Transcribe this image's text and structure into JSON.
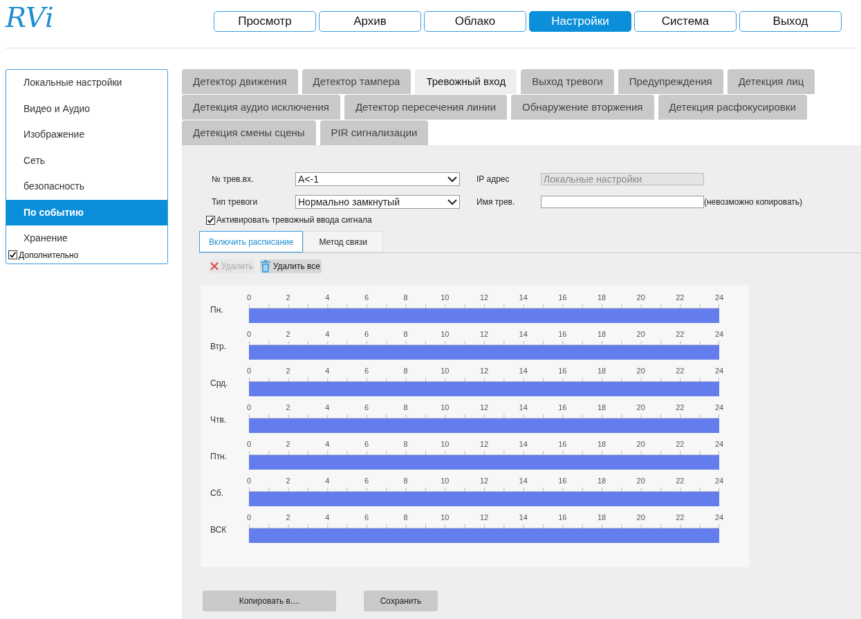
{
  "logo": "RVi",
  "nav": [
    {
      "label": "Просмотр",
      "selected": false
    },
    {
      "label": "Архив",
      "selected": false
    },
    {
      "label": "Облако",
      "selected": false
    },
    {
      "label": "Настройки",
      "selected": true
    },
    {
      "label": "Система",
      "selected": false
    },
    {
      "label": "Выход",
      "selected": false
    }
  ],
  "sidebar": {
    "items": [
      {
        "label": "Локальные настройки",
        "selected": false
      },
      {
        "label": "Видео и Аудио",
        "selected": false
      },
      {
        "label": "Изображение",
        "selected": false
      },
      {
        "label": "Сеть",
        "selected": false
      },
      {
        "label": "безопасность",
        "selected": false
      },
      {
        "label": "По событию",
        "selected": true
      },
      {
        "label": "Хранение",
        "selected": false
      }
    ],
    "advanced": {
      "label": "Дополнительно",
      "checked": true
    }
  },
  "tab_rows": [
    [
      {
        "label": "Детектор движения",
        "selected": false
      },
      {
        "label": "Детектор тампера",
        "selected": false
      },
      {
        "label": "Тревожный вход",
        "selected": true
      },
      {
        "label": "Выход тревоги",
        "selected": false
      },
      {
        "label": "Предупреждения",
        "selected": false
      },
      {
        "label": "Детекция лиц",
        "selected": false
      }
    ],
    [
      {
        "label": "Детекция аудио исключения",
        "selected": false
      },
      {
        "label": "Детектор пересечения линии",
        "selected": false
      },
      {
        "label": "Обнаружение вторжения",
        "selected": false
      },
      {
        "label": "Детекция расфокусировки",
        "selected": false
      }
    ],
    [
      {
        "label": "Детекция смены сцены",
        "selected": false
      },
      {
        "label": "PIR сигнализации",
        "selected": false
      }
    ]
  ],
  "form": {
    "alarm_input": {
      "label": "№ трев.вх.",
      "value": "A<-1"
    },
    "ip_address": {
      "label": "IP адрес",
      "value": "Локальные настройки",
      "disabled": true
    },
    "alarm_type": {
      "label": "Тип тревоги",
      "value": "Нормально замкнутый"
    },
    "alarm_name": {
      "label": "Имя трев.",
      "note": "(невозможно копировать)"
    },
    "activate": {
      "label": "Активировать тревожный ввода сигнала",
      "checked": true
    }
  },
  "subtabs": [
    {
      "label": "Включить расписание",
      "selected": true
    },
    {
      "label": "Метод связи",
      "selected": false
    }
  ],
  "toolbar": [
    {
      "kind": "delete",
      "label": "Удалить",
      "disabled": true
    },
    {
      "kind": "delete_all",
      "label": "Удалить все",
      "disabled": false
    }
  ],
  "schedule": [
    {
      "day": "Пн.",
      "level": 1,
      "ticks": [
        "0",
        "2",
        "4",
        "6",
        "8",
        "10",
        "12",
        "14",
        "16",
        "18",
        "20",
        "22",
        "24"
      ]
    },
    {
      "day": "Втр.",
      "level": 1,
      "ticks": [
        "0",
        "2",
        "4",
        "6",
        "8",
        "10",
        "12",
        "14",
        "16",
        "18",
        "20",
        "22",
        "24"
      ]
    },
    {
      "day": "Срд.",
      "level": 1,
      "ticks": [
        "0",
        "2",
        "4",
        "6",
        "8",
        "10",
        "12",
        "14",
        "16",
        "18",
        "20",
        "22",
        "24"
      ]
    },
    {
      "day": "Чтв.",
      "level": 1,
      "ticks": [
        "0",
        "2",
        "4",
        "6",
        "8",
        "10",
        "12",
        "14",
        "16",
        "18",
        "20",
        "22",
        "24"
      ]
    },
    {
      "day": "Птн.",
      "level": 1,
      "ticks": [
        "0",
        "2",
        "4",
        "6",
        "8",
        "10",
        "12",
        "14",
        "16",
        "18",
        "20",
        "22",
        "24"
      ]
    },
    {
      "day": "Сб.",
      "level": 1,
      "ticks": [
        "0",
        "2",
        "4",
        "6",
        "8",
        "10",
        "12",
        "14",
        "16",
        "18",
        "20",
        "22",
        "24"
      ]
    },
    {
      "day": "ВСК",
      "level": 1,
      "ticks": [
        "0",
        "2",
        "4",
        "6",
        "8",
        "10",
        "12",
        "14",
        "16",
        "18",
        "20",
        "22",
        "24"
      ]
    }
  ],
  "buttons": [
    "Копировать в....",
    "Сохранить"
  ]
}
